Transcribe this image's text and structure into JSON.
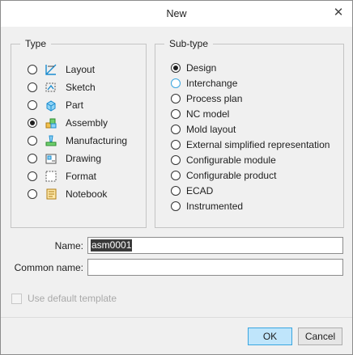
{
  "window": {
    "title": "New",
    "close_icon": "close-icon"
  },
  "type_group": {
    "legend": "Type",
    "selected": "Assembly",
    "items": [
      {
        "label": "Layout",
        "icon": "layout-icon",
        "checked": false
      },
      {
        "label": "Sketch",
        "icon": "sketch-icon",
        "checked": false
      },
      {
        "label": "Part",
        "icon": "part-icon",
        "checked": false
      },
      {
        "label": "Assembly",
        "icon": "assembly-icon",
        "checked": true
      },
      {
        "label": "Manufacturing",
        "icon": "manufacturing-icon",
        "checked": false
      },
      {
        "label": "Drawing",
        "icon": "drawing-icon",
        "checked": false
      },
      {
        "label": "Format",
        "icon": "format-icon",
        "checked": false
      },
      {
        "label": "Notebook",
        "icon": "notebook-icon",
        "checked": false
      }
    ]
  },
  "subtype_group": {
    "legend": "Sub-type",
    "selected": "Design",
    "items": [
      {
        "label": "Design",
        "checked": true
      },
      {
        "label": "Interchange",
        "checked": false
      },
      {
        "label": "Process plan",
        "checked": false
      },
      {
        "label": "NC model",
        "checked": false
      },
      {
        "label": "Mold layout",
        "checked": false
      },
      {
        "label": "External simplified representation",
        "checked": false
      },
      {
        "label": "Configurable module",
        "checked": false
      },
      {
        "label": "Configurable product",
        "checked": false
      },
      {
        "label": "ECAD",
        "checked": false
      },
      {
        "label": "Instrumented",
        "checked": false
      }
    ]
  },
  "fields": {
    "name_label": "Name:",
    "name_value": "asm0001",
    "common_name_label": "Common name:",
    "common_name_value": ""
  },
  "options": {
    "default_template_label": "Use default template",
    "default_template_checked": false,
    "default_template_enabled": false
  },
  "buttons": {
    "ok": "OK",
    "cancel": "Cancel"
  },
  "colors": {
    "accent": "#3aa6e0",
    "ok_fill": "#bfe5fb",
    "dialog_bg": "#f0f0f0",
    "selection": "#3a3a3a"
  }
}
